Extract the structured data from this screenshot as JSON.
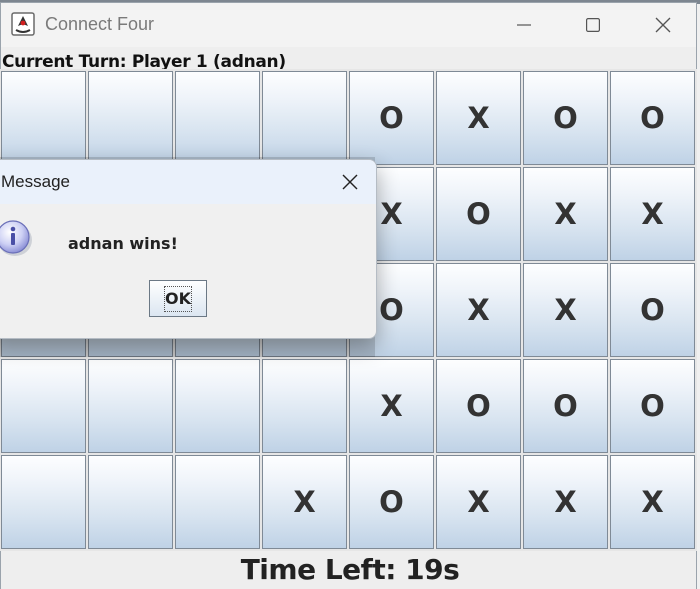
{
  "window": {
    "title": "Connect Four",
    "icon": "java-duke-icon",
    "controls": [
      "minimize-icon",
      "maximize-icon",
      "close-icon"
    ]
  },
  "turn_label": "Current Turn: Player 1 (adnan)",
  "board": {
    "rows": 5,
    "cols": 8,
    "cells": [
      [
        "",
        "",
        "",
        "",
        "O",
        "X",
        "O",
        "O"
      ],
      [
        "",
        "",
        "",
        "",
        "X",
        "O",
        "X",
        "X"
      ],
      [
        "",
        "",
        "",
        "",
        "O",
        "X",
        "X",
        "O"
      ],
      [
        "",
        "",
        "",
        "",
        "X",
        "O",
        "O",
        "O"
      ],
      [
        "",
        "",
        "",
        "X",
        "O",
        "X",
        "X",
        "X"
      ]
    ]
  },
  "timer": "Time Left: 19s",
  "dialog": {
    "title": "Message",
    "message": "adnan wins!",
    "ok_label": "OK",
    "icon": "info-icon"
  }
}
